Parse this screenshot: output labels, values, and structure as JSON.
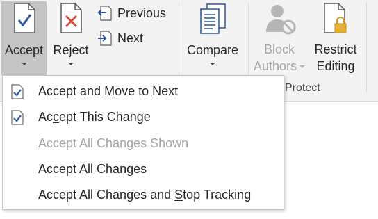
{
  "ribbon": {
    "accept_label": "Accept",
    "reject_label": "Reject",
    "previous_label": "Previous",
    "next_label": "Next",
    "compare_label": "Compare",
    "block_authors_line1": "Block",
    "block_authors_line2": "Authors",
    "restrict_editing_line1": "Restrict",
    "restrict_editing_line2": "Editing",
    "protect_group_label": "Protect",
    "accent_color": "#2b579a",
    "reject_color": "#d9443a",
    "lock_color": "#e8b030"
  },
  "accept_menu": {
    "items": [
      {
        "pre": "Accept and ",
        "key": "M",
        "post": "ove to Next",
        "checked": true,
        "enabled": true
      },
      {
        "pre": "Ac",
        "key": "c",
        "post": "ept This Change",
        "checked": true,
        "enabled": true
      },
      {
        "pre": "",
        "key": "A",
        "post": "ccept All Changes Shown",
        "checked": false,
        "enabled": false
      },
      {
        "pre": "Accept A",
        "key": "l",
        "post": "l Changes",
        "checked": false,
        "enabled": true
      },
      {
        "pre": "Accept All Changes and ",
        "key": "S",
        "post": "top Tracking",
        "checked": false,
        "enabled": true
      }
    ]
  }
}
